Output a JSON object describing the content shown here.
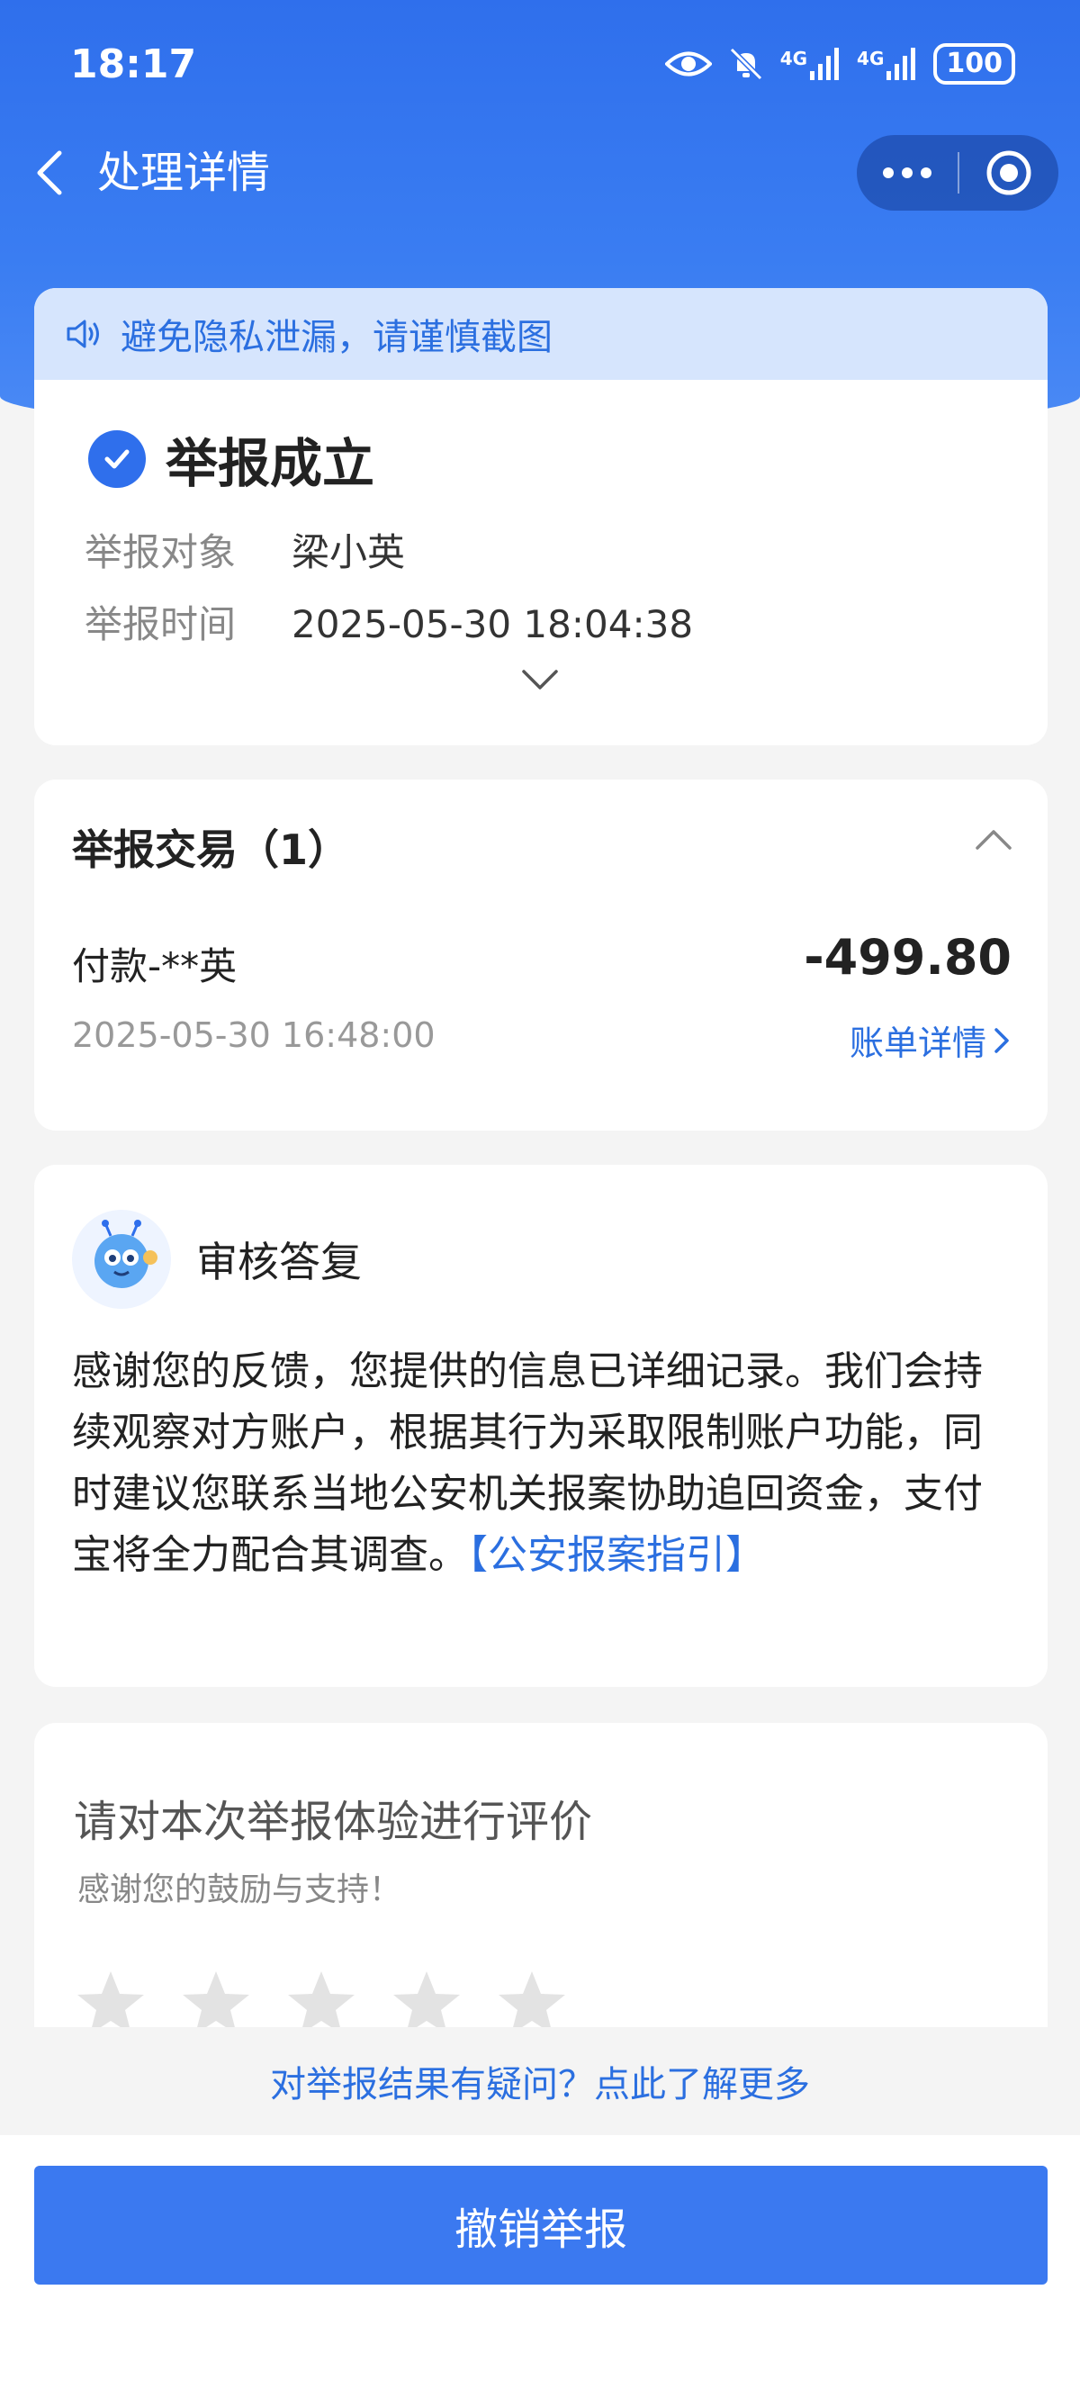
{
  "status_bar": {
    "time": "18:17",
    "network1": "4G",
    "network2": "4G",
    "battery": "100"
  },
  "nav": {
    "title": "处理详情"
  },
  "notice": {
    "text": "避免隐私泄漏，请谨慎截图"
  },
  "result": {
    "status": "举报成立",
    "target_label": "举报对象",
    "target_value": "梁小英",
    "time_label": "举报时间",
    "time_value": "2025-05-30 18:04:38"
  },
  "transactions": {
    "title": "举报交易（1）",
    "items": [
      {
        "name": "付款-**英",
        "time": "2025-05-30 16:48:00",
        "amount": "-499.80",
        "link": "账单详情"
      }
    ]
  },
  "reply": {
    "title": "审核答复",
    "text": "感谢您的反馈，您提供的信息已详细记录。我们会持续观察对方账户，根据其行为采取限制账户功能，同时建议您联系当地公安机关报案协助追回资金，支付宝将全力配合其调查。",
    "link": "【公安报案指引】"
  },
  "rating": {
    "title": "请对本次举报体验进行评价",
    "subtitle": "感谢您的鼓励与支持！",
    "stars": 5
  },
  "faq": {
    "text": "对举报结果有疑问？点此了解更多"
  },
  "primary_button": {
    "label": "撤销举报"
  },
  "colors": {
    "brand_blue": "#2f6fec",
    "link_blue": "#2b6fe0",
    "notice_bg": "#d6e5fd"
  }
}
